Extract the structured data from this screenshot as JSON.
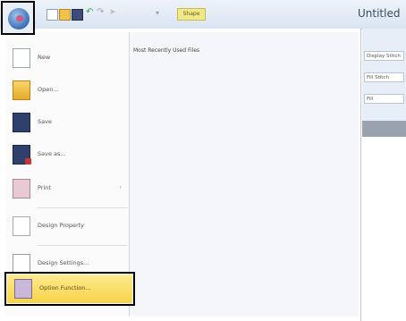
{
  "window": {
    "title": "Untitled"
  },
  "qat": {
    "shape_badge": "Shape",
    "icons": [
      "new-icon",
      "open-icon",
      "save-icon",
      "undo-icon",
      "redo-icon",
      "dropdown-icon"
    ]
  },
  "ribbon_right": {
    "fields": [
      "Display Stitch",
      "Fill Stitch",
      "Fill"
    ]
  },
  "menu": {
    "recent_title": "Most Recently Used Files",
    "items": [
      {
        "label": "New",
        "icon": "new-file-icon"
      },
      {
        "label": "Open...",
        "icon": "folder-open-icon"
      },
      {
        "label": "Save",
        "icon": "save-disk-icon"
      },
      {
        "label": "Save as...",
        "icon": "save-as-icon"
      },
      {
        "label": "Print",
        "icon": "print-icon",
        "arrow": "›"
      },
      {
        "label": "Design Property",
        "icon": "design-property-icon"
      },
      {
        "label": "Design Settings...",
        "icon": "design-settings-icon"
      },
      {
        "label": "Option Function...",
        "icon": "option-icon"
      }
    ]
  }
}
